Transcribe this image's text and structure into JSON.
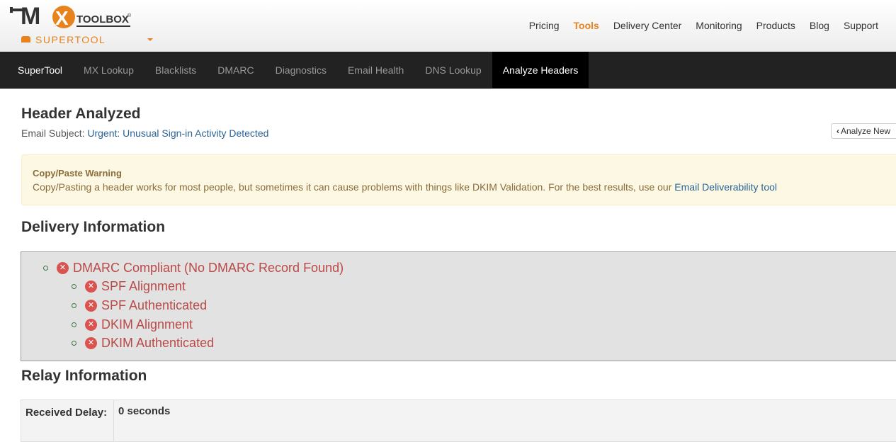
{
  "header": {
    "logo_text": "MX TOOLBOX",
    "supertool_label": "SUPERTOOL",
    "nav": [
      "Pricing",
      "Tools",
      "Delivery Center",
      "Monitoring",
      "Products",
      "Blog",
      "Support"
    ],
    "active_nav": "Tools",
    "brand_color": "#e8821d"
  },
  "toolbar": {
    "items": [
      "SuperTool",
      "MX Lookup",
      "Blacklists",
      "DMARC",
      "Diagnostics",
      "Email Health",
      "DNS Lookup",
      "Analyze Headers"
    ],
    "active": "Analyze Headers"
  },
  "page": {
    "title": "Header Analyzed",
    "subject_label": "Email Subject:",
    "subject_value": "Urgent: Unusual Sign-in Activity Detected",
    "analyze_new_label": "Analyze New"
  },
  "warning": {
    "title": "Copy/Paste Warning",
    "text": "Copy/Pasting a header works for most people, but sometimes it can cause problems with things like DKIM Validation. For the best results, use our ",
    "link": "Email Deliverability tool"
  },
  "delivery": {
    "title": "Delivery Information",
    "items": [
      {
        "label": "DMARC Compliant (No DMARC Record Found)",
        "status": "fail"
      },
      {
        "label": "SPF Alignment",
        "status": "fail"
      },
      {
        "label": "SPF Authenticated",
        "status": "fail"
      },
      {
        "label": "DKIM Alignment",
        "status": "fail"
      },
      {
        "label": "DKIM Authenticated",
        "status": "fail"
      }
    ],
    "fail_color": "#d9534f"
  },
  "relay": {
    "title": "Relay Information",
    "received_delay_label": "Received Delay:",
    "received_delay_value": "0 seconds"
  }
}
